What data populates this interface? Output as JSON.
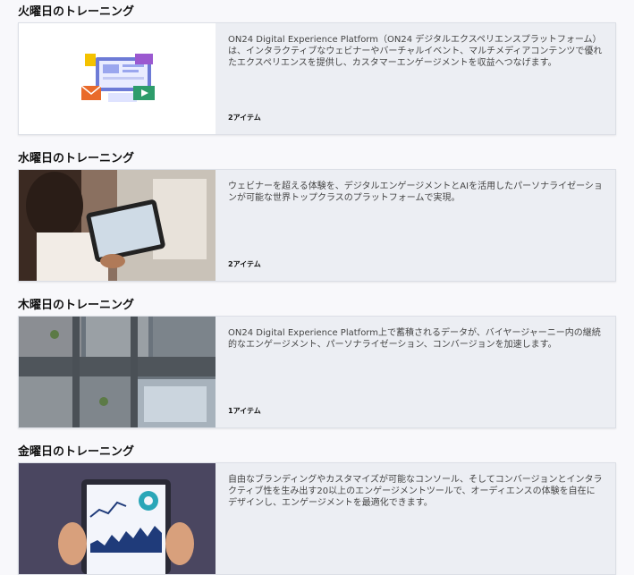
{
  "sections": [
    {
      "title": "火曜日のトレーニング",
      "description": "ON24 Digital Experience Platform（ON24 デジタルエクスペリエンスプラットフォーム）は、インタラクティブなウェビナーやバーチャルイベント、マルチメディアコンテンツで優れたエクスペリエンスを提供し、カスタマーエンゲージメントを収益へつなげます。",
      "count": "2アイテム"
    },
    {
      "title": "水曜日のトレーニング",
      "description": "ウェビナーを超える体験を、デジタルエンゲージメントとAIを活用したパーソナライゼーションが可能な世界トップクラスのプラットフォームで実現。",
      "count": "2アイテム"
    },
    {
      "title": "木曜日のトレーニング",
      "description": "ON24 Digital Experience Platform上で蓄積されるデータが、バイヤージャーニー内の継続的なエンゲージメント、パーソナライゼーション、コンバージョンを加速します。",
      "count": "1アイテム"
    },
    {
      "title": "金曜日のトレーニング",
      "description": "自由なブランディングやカスタマイズが可能なコンソール、そしてコンバージョンとインタラクティブ性を生み出す20以上のエンゲージメントツールで、オーディエンスの体験を自在にデザインし、エンゲージメントを最適化できます。",
      "count": ""
    }
  ]
}
